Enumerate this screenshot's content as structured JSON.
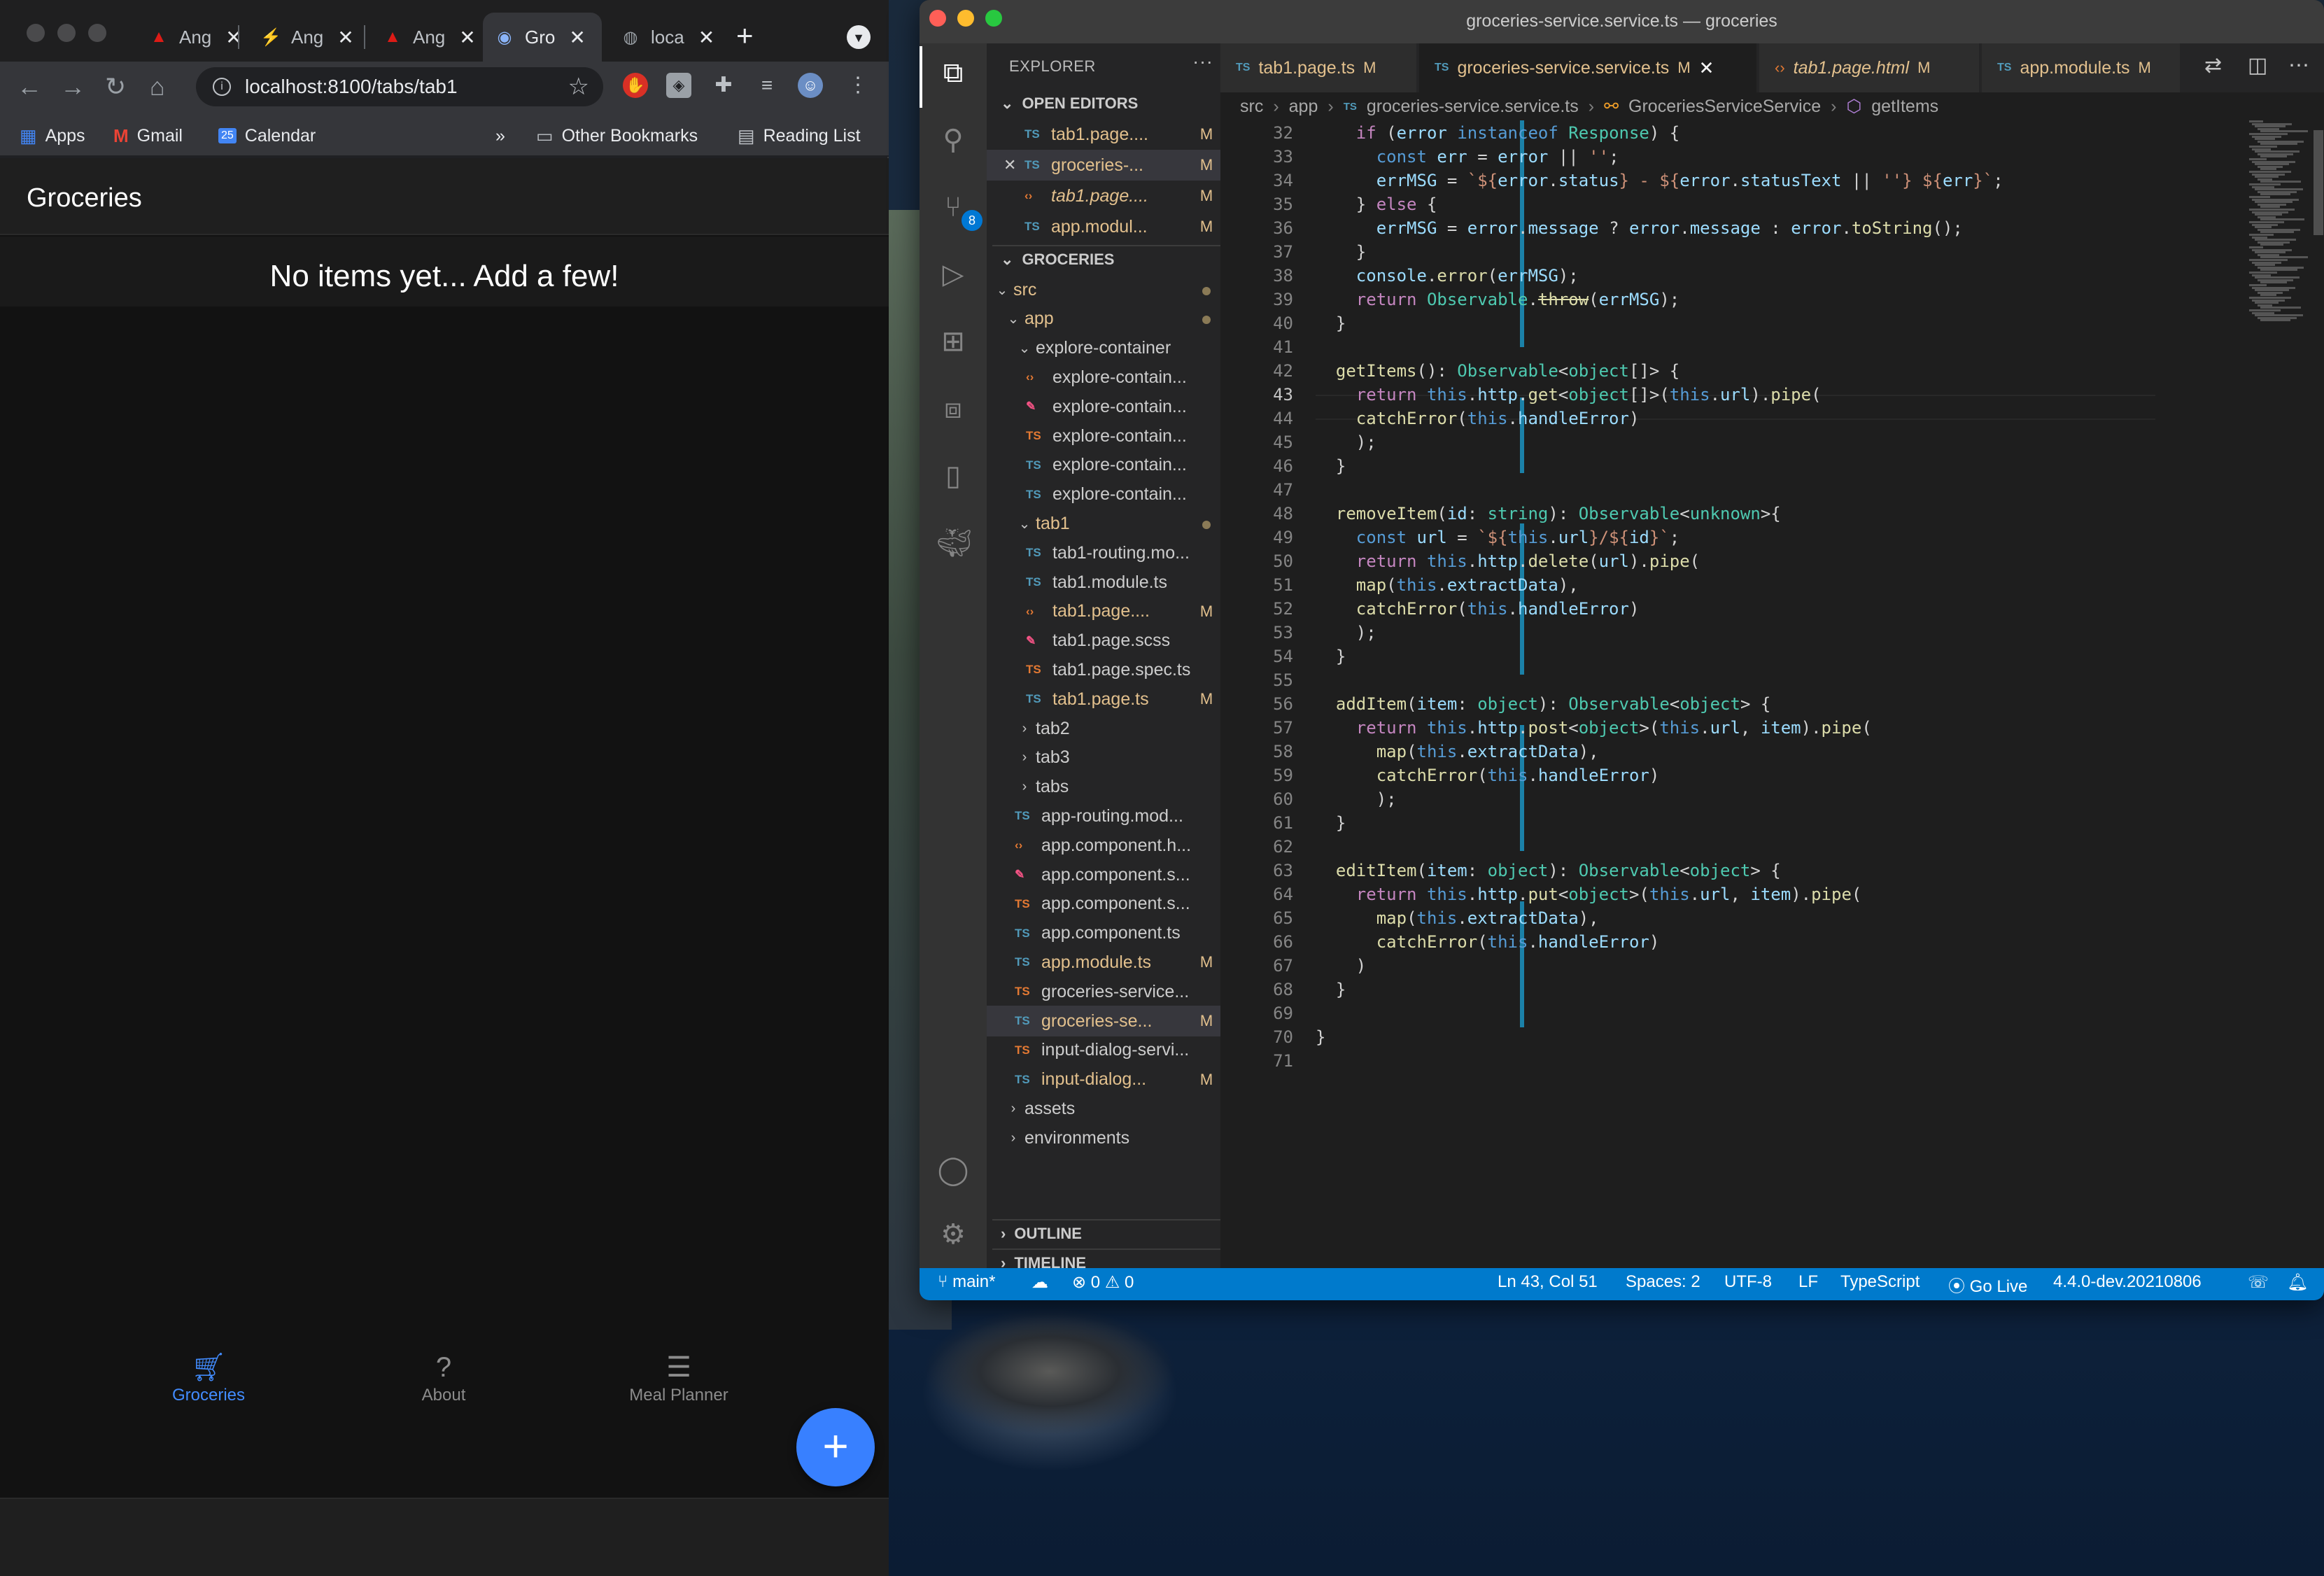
{
  "chrome": {
    "tabs": [
      {
        "label": "Ang",
        "icon": "angular-icon"
      },
      {
        "label": "Ang",
        "icon": "bolt-icon"
      },
      {
        "label": "Ang",
        "icon": "angular-icon"
      },
      {
        "label": "Gro",
        "icon": "chrome-icon",
        "active": true
      },
      {
        "label": "loca",
        "icon": "globe-icon"
      }
    ],
    "url": "localhost:8100/tabs/tab1",
    "bookmarks": {
      "apps": "Apps",
      "gmail": "Gmail",
      "calendar": "Calendar",
      "more": "»",
      "other": "Other Bookmarks",
      "reading": "Reading List"
    },
    "calendar_day": "25"
  },
  "app": {
    "title": "Groceries",
    "empty_message": "No items yet... Add a few!",
    "fab_label": "+",
    "tabs": [
      {
        "label": "Groceries",
        "icon": "cart-icon",
        "selected": true
      },
      {
        "label": "About",
        "icon": "question-icon"
      },
      {
        "label": "Meal Planner",
        "icon": "list-icon"
      }
    ]
  },
  "vscode": {
    "title": "groceries-service.service.ts — groceries",
    "source_control_badge": "8",
    "sidebar": {
      "header": "EXPLORER",
      "more": "···",
      "open_editors_label": "OPEN EDITORS",
      "open_editors": [
        {
          "name": "tab1.page....",
          "type": "ts",
          "status": "M"
        },
        {
          "name": "groceries-...",
          "type": "ts",
          "status": "M",
          "selected": true,
          "close": "✕"
        },
        {
          "name": "tab1.page....",
          "type": "html",
          "status": "M",
          "italic": true
        },
        {
          "name": "app.modul...",
          "type": "ts",
          "status": "M"
        }
      ],
      "project_label": "GROCERIES",
      "tree": [
        {
          "name": "src",
          "kind": "folder",
          "depth": 0,
          "open": true,
          "dot": true
        },
        {
          "name": "app",
          "kind": "folder",
          "depth": 1,
          "open": true,
          "dot": true
        },
        {
          "name": "explore-container",
          "kind": "folder",
          "depth": 2,
          "open": true
        },
        {
          "name": "explore-contain...",
          "type": "html",
          "depth": 3
        },
        {
          "name": "explore-contain...",
          "type": "scss",
          "depth": 3
        },
        {
          "name": "explore-contain...",
          "type": "spec",
          "depth": 3
        },
        {
          "name": "explore-contain...",
          "type": "ts",
          "depth": 3
        },
        {
          "name": "explore-contain...",
          "type": "ts",
          "depth": 3
        },
        {
          "name": "tab1",
          "kind": "folder",
          "depth": 2,
          "open": true,
          "dot": true
        },
        {
          "name": "tab1-routing.mo...",
          "type": "ts",
          "depth": 3
        },
        {
          "name": "tab1.module.ts",
          "type": "ts",
          "depth": 3
        },
        {
          "name": "tab1.page....",
          "type": "html",
          "depth": 3,
          "status": "M"
        },
        {
          "name": "tab1.page.scss",
          "type": "scss",
          "depth": 3
        },
        {
          "name": "tab1.page.spec.ts",
          "type": "spec",
          "depth": 3
        },
        {
          "name": "tab1.page.ts",
          "type": "ts",
          "depth": 3,
          "status": "M"
        },
        {
          "name": "tab2",
          "kind": "folder",
          "depth": 2,
          "open": false
        },
        {
          "name": "tab3",
          "kind": "folder",
          "depth": 2,
          "open": false
        },
        {
          "name": "tabs",
          "kind": "folder",
          "depth": 2,
          "open": false
        },
        {
          "name": "app-routing.mod...",
          "type": "ts",
          "depth": 2
        },
        {
          "name": "app.component.h...",
          "type": "html",
          "depth": 2
        },
        {
          "name": "app.component.s...",
          "type": "scss",
          "depth": 2
        },
        {
          "name": "app.component.s...",
          "type": "spec",
          "depth": 2
        },
        {
          "name": "app.component.ts",
          "type": "ts",
          "depth": 2
        },
        {
          "name": "app.module.ts",
          "type": "ts",
          "depth": 2,
          "status": "M"
        },
        {
          "name": "groceries-service...",
          "type": "spec",
          "depth": 2
        },
        {
          "name": "groceries-se...",
          "type": "ts",
          "depth": 2,
          "status": "M",
          "selected": true
        },
        {
          "name": "input-dialog-servi...",
          "type": "spec",
          "depth": 2
        },
        {
          "name": "input-dialog...",
          "type": "ts",
          "depth": 2,
          "status": "M"
        },
        {
          "name": "assets",
          "kind": "folder",
          "depth": 1,
          "open": false
        },
        {
          "name": "environments",
          "kind": "folder",
          "depth": 1,
          "open": false
        }
      ],
      "outline_label": "OUTLINE",
      "timeline_label": "TIMELINE"
    },
    "editor_tabs": [
      {
        "name": "tab1.page.ts",
        "type": "ts",
        "status": "M"
      },
      {
        "name": "groceries-service.service.ts",
        "type": "ts",
        "status": "M",
        "active": true,
        "close": "✕"
      },
      {
        "name": "tab1.page.html",
        "type": "html",
        "status": "M",
        "italic": true
      },
      {
        "name": "app.module.ts",
        "type": "ts",
        "status": "M"
      }
    ],
    "breadcrumb": {
      "parts": [
        "src",
        "app",
        "groceries-service.service.ts",
        "GroceriesServiceService",
        "getItems"
      ],
      "separator": "›"
    },
    "cursor_line": 43,
    "code": [
      {
        "n": 32,
        "html": "    <span class=\"kw\">if</span> (<span class=\"vr\">error</span> <span class=\"kb\">instanceof</span> <span class=\"ty\">Response</span>) {"
      },
      {
        "n": 33,
        "html": "      <span class=\"kb\">const</span> <span class=\"vr\">err</span> = <span class=\"vr\">error</span> || <span class=\"st\">''</span>;"
      },
      {
        "n": 34,
        "html": "      <span class=\"vr\">errMSG</span> = <span class=\"st\">`${</span><span class=\"vr\">error</span>.<span class=\"vr\">status</span><span class=\"st\">} - ${</span><span class=\"vr\">error</span>.<span class=\"vr\">statusText</span> || <span class=\"st\">''</span><span class=\"st\">} ${</span><span class=\"vr\">err</span><span class=\"st\">}`</span>;"
      },
      {
        "n": 35,
        "html": "    } <span class=\"kw\">else</span> {"
      },
      {
        "n": 36,
        "html": "      <span class=\"vr\">errMSG</span> = <span class=\"vr\">error</span>.<span class=\"vr\">message</span> ? <span class=\"vr\">error</span>.<span class=\"vr\">message</span> : <span class=\"vr\">error</span>.<span class=\"fn\">toString</span>();"
      },
      {
        "n": 37,
        "html": "    }"
      },
      {
        "n": 38,
        "html": "    <span class=\"vr\">console</span>.<span class=\"fn\">error</span>(<span class=\"vr\">errMSG</span>);"
      },
      {
        "n": 39,
        "html": "    <span class=\"kw\">return</span> <span class=\"ty\">Observable</span>.<span class=\"fn strike\">throw</span>(<span class=\"vr\">errMSG</span>);"
      },
      {
        "n": 40,
        "html": "  }"
      },
      {
        "n": 41,
        "html": ""
      },
      {
        "n": 42,
        "html": "  <span class=\"fn\">getItems</span>(): <span class=\"ty\">Observable</span>&lt;<span class=\"ty\">object</span>[]&gt; {"
      },
      {
        "n": 43,
        "html": "    <span class=\"kw\">return</span> <span class=\"kb\">this</span>.<span class=\"vr\">http</span>.<span class=\"fn\">get</span>&lt;<span class=\"ty\">object</span>[]&gt;(<span class=\"kb\">this</span>.<span class=\"vr\">url</span>).<span class=\"fn\">pipe</span>("
      },
      {
        "n": 44,
        "html": "    <span class=\"fn\">catchError</span>(<span class=\"kb\">this</span>.<span class=\"vr\">handleError</span>)"
      },
      {
        "n": 45,
        "html": "    );"
      },
      {
        "n": 46,
        "html": "  }"
      },
      {
        "n": 47,
        "html": ""
      },
      {
        "n": 48,
        "html": "  <span class=\"fn\">removeItem</span>(<span class=\"vr\">id</span>: <span class=\"ty\">string</span>): <span class=\"ty\">Observable</span>&lt;<span class=\"ty\">unknown</span>&gt;{"
      },
      {
        "n": 49,
        "html": "    <span class=\"kb\">const</span> <span class=\"vr\">url</span> = <span class=\"st\">`${</span><span class=\"kb\">this</span>.<span class=\"vr\">url</span><span class=\"st\">}/${</span><span class=\"vr\">id</span><span class=\"st\">}`</span>;"
      },
      {
        "n": 50,
        "html": "    <span class=\"kw\">return</span> <span class=\"kb\">this</span>.<span class=\"vr\">http</span>.<span class=\"fn\">delete</span>(<span class=\"vr\">url</span>).<span class=\"fn\">pipe</span>("
      },
      {
        "n": 51,
        "html": "    <span class=\"fn\">map</span>(<span class=\"kb\">this</span>.<span class=\"vr\">extractData</span>),"
      },
      {
        "n": 52,
        "html": "    <span class=\"fn\">catchError</span>(<span class=\"kb\">this</span>.<span class=\"vr\">handleError</span>)"
      },
      {
        "n": 53,
        "html": "    );"
      },
      {
        "n": 54,
        "html": "  }"
      },
      {
        "n": 55,
        "html": ""
      },
      {
        "n": 56,
        "html": "  <span class=\"fn\">addItem</span>(<span class=\"vr\">item</span>: <span class=\"ty\">object</span>): <span class=\"ty\">Observable</span>&lt;<span class=\"ty\">object</span>&gt; {"
      },
      {
        "n": 57,
        "html": "    <span class=\"kw\">return</span> <span class=\"kb\">this</span>.<span class=\"vr\">http</span>.<span class=\"fn\">post</span>&lt;<span class=\"ty\">object</span>&gt;(<span class=\"kb\">this</span>.<span class=\"vr\">url</span>, <span class=\"vr\">item</span>).<span class=\"fn\">pipe</span>("
      },
      {
        "n": 58,
        "html": "      <span class=\"fn\">map</span>(<span class=\"kb\">this</span>.<span class=\"vr\">extractData</span>),"
      },
      {
        "n": 59,
        "html": "      <span class=\"fn\">catchError</span>(<span class=\"kb\">this</span>.<span class=\"vr\">handleError</span>)"
      },
      {
        "n": 60,
        "html": "      );"
      },
      {
        "n": 61,
        "html": "  }"
      },
      {
        "n": 62,
        "html": ""
      },
      {
        "n": 63,
        "html": "  <span class=\"fn\">editItem</span>(<span class=\"vr\">item</span>: <span class=\"ty\">object</span>): <span class=\"ty\">Observable</span>&lt;<span class=\"ty\">object</span>&gt; {"
      },
      {
        "n": 64,
        "html": "    <span class=\"kw\">return</span> <span class=\"kb\">this</span>.<span class=\"vr\">http</span>.<span class=\"fn\">put</span>&lt;<span class=\"ty\">object</span>&gt;(<span class=\"kb\">this</span>.<span class=\"vr\">url</span>, <span class=\"vr\">item</span>).<span class=\"fn\">pipe</span>("
      },
      {
        "n": 65,
        "html": "      <span class=\"fn\">map</span>(<span class=\"kb\">this</span>.<span class=\"vr\">extractData</span>),"
      },
      {
        "n": 66,
        "html": "      <span class=\"fn\">catchError</span>(<span class=\"kb\">this</span>.<span class=\"vr\">handleError</span>)"
      },
      {
        "n": 67,
        "html": "    )"
      },
      {
        "n": 68,
        "html": "  }"
      },
      {
        "n": 69,
        "html": ""
      },
      {
        "n": 70,
        "html": "}"
      },
      {
        "n": 71,
        "html": ""
      }
    ],
    "status": {
      "branch": "main*",
      "errors": "0",
      "warnings": "0",
      "position": "Ln 43, Col 51",
      "spaces": "Spaces: 2",
      "encoding": "UTF-8",
      "eol": "LF",
      "language": "TypeScript",
      "golive": "Go Live",
      "version": "4.4.0-dev.20210806"
    }
  },
  "colors": {
    "ionic_primary": "#3880ff",
    "tab_selected": "#428cff",
    "vscode_status": "#007acc",
    "git_modified": "#e2c08d"
  }
}
